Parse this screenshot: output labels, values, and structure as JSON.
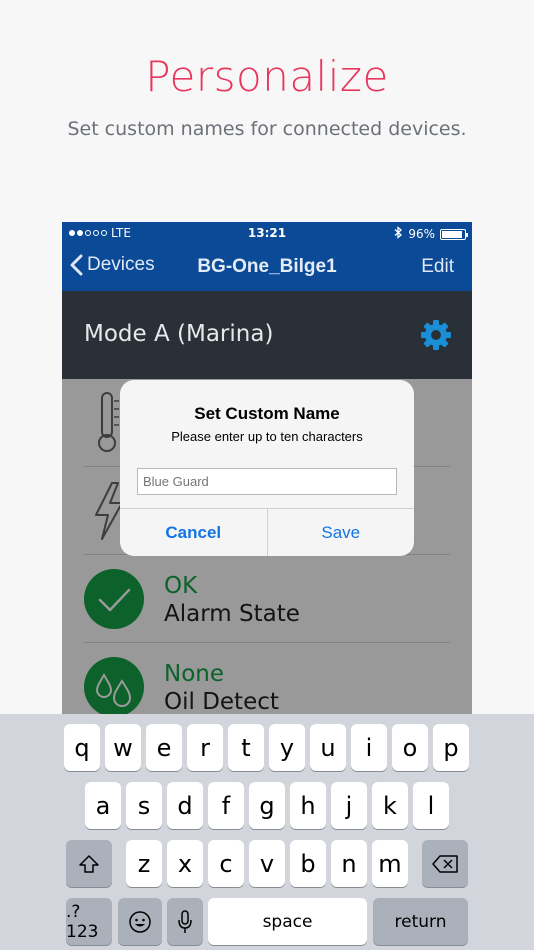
{
  "promo": {
    "title": "Personalize",
    "subtitle": "Set custom names for connected devices."
  },
  "status_bar": {
    "carrier": "LTE",
    "time": "13:21",
    "battery_pct": "96%",
    "battery_level": 0.96,
    "signal_bars_filled": 2
  },
  "nav": {
    "back_label": "Devices",
    "title": "BG-One_Bilge1",
    "edit_label": "Edit"
  },
  "mode": {
    "label": "Mode A (Marina)"
  },
  "list": {
    "rows": [
      {
        "icon": "thermometer-icon",
        "status": "",
        "label": ""
      },
      {
        "icon": "lightning-icon",
        "status": "",
        "label": ""
      },
      {
        "icon": "checkmark-icon",
        "status": "OK",
        "label": "Alarm State"
      },
      {
        "icon": "droplets-icon",
        "status": "None",
        "label": "Oil Detect"
      }
    ]
  },
  "alert": {
    "title": "Set Custom Name",
    "message": "Please enter up to ten characters",
    "input_placeholder": "Blue Guard",
    "cancel_label": "Cancel",
    "save_label": "Save"
  },
  "keyboard": {
    "row1": [
      "q",
      "w",
      "e",
      "r",
      "t",
      "y",
      "u",
      "i",
      "o",
      "p"
    ],
    "row2": [
      "a",
      "s",
      "d",
      "f",
      "g",
      "h",
      "j",
      "k",
      "l"
    ],
    "row3": [
      "z",
      "x",
      "c",
      "v",
      "b",
      "n",
      "m"
    ],
    "numbers_label": ".?123",
    "space_label": "space",
    "return_label": "return"
  },
  "colors": {
    "accent_pink": "#e8365d",
    "nav_blue": "#0b4a97",
    "mode_dark": "#2a3038",
    "status_green": "#16a348",
    "ios_blue": "#1274e5"
  }
}
